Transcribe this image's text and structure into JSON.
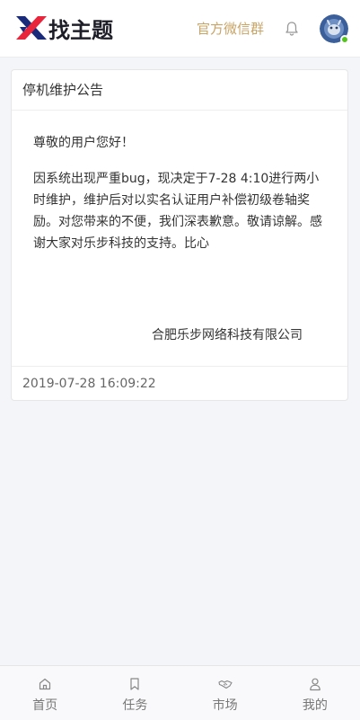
{
  "header": {
    "logo_text": "找主题",
    "wechat_group": "官方微信群",
    "bell_icon": "bell-icon",
    "avatar_icon": "user-avatar",
    "online_color": "#52c41a"
  },
  "notice": {
    "title": "停机维护公告",
    "greeting": "尊敬的用户您好！",
    "content": "因系统出现严重bug，现决定于7-28 4:10进行两小时维护，维护后对以实名认证用户补偿初级卷轴奖励。对您带来的不便，我们深表歉意。敬请谅解。感谢大家对乐步科技的支持。比心",
    "signature": "合肥乐步网络科技有限公司",
    "timestamp": "2019-07-28 16:09:22"
  },
  "bottom_nav": {
    "items": [
      {
        "label": "首页",
        "icon": "home-icon"
      },
      {
        "label": "任务",
        "icon": "bookmark-icon"
      },
      {
        "label": "市场",
        "icon": "handshake-icon"
      },
      {
        "label": "我的",
        "icon": "user-icon"
      }
    ]
  },
  "colors": {
    "accent_gold": "#c8a466",
    "brand_red": "#e8253a",
    "brand_navy": "#1a2a7a",
    "page_bg": "#f4f5f9"
  }
}
